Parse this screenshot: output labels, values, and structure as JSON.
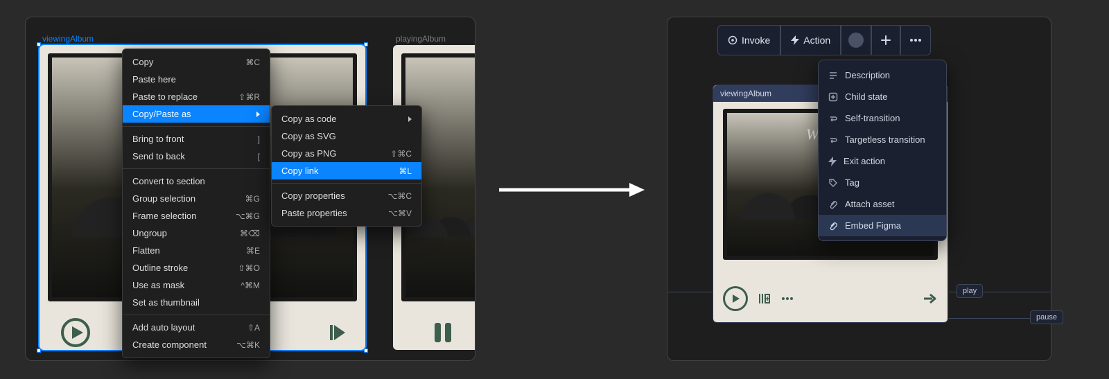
{
  "left": {
    "labels": {
      "viewing": "viewingAlbum",
      "playing": "playingAlbum"
    },
    "menu1": {
      "copy": {
        "label": "Copy",
        "sc": "⌘C"
      },
      "paste_here": {
        "label": "Paste here",
        "sc": ""
      },
      "paste_replace": {
        "label": "Paste to replace",
        "sc": "⇧⌘R"
      },
      "copy_paste_as": {
        "label": "Copy/Paste as",
        "sc": ""
      },
      "bring_front": {
        "label": "Bring to front",
        "sc": "]"
      },
      "send_back": {
        "label": "Send to back",
        "sc": "["
      },
      "convert_sec": {
        "label": "Convert to section",
        "sc": ""
      },
      "group_sel": {
        "label": "Group selection",
        "sc": "⌘G"
      },
      "frame_sel": {
        "label": "Frame selection",
        "sc": "⌥⌘G"
      },
      "ungroup": {
        "label": "Ungroup",
        "sc": "⌘⌫"
      },
      "flatten": {
        "label": "Flatten",
        "sc": "⌘E"
      },
      "outline": {
        "label": "Outline stroke",
        "sc": "⇧⌘O"
      },
      "mask": {
        "label": "Use as mask",
        "sc": "^⌘M"
      },
      "thumb": {
        "label": "Set as thumbnail",
        "sc": ""
      },
      "auto_layout": {
        "label": "Add auto layout",
        "sc": "⇧A"
      },
      "create_comp": {
        "label": "Create component",
        "sc": "⌥⌘K"
      }
    },
    "menu2": {
      "as_code": {
        "label": "Copy as code",
        "sc": ""
      },
      "as_svg": {
        "label": "Copy as SVG",
        "sc": ""
      },
      "as_png": {
        "label": "Copy as PNG",
        "sc": "⇧⌘C"
      },
      "link": {
        "label": "Copy link",
        "sc": "⌘L"
      },
      "props": {
        "label": "Copy properties",
        "sc": "⌥⌘C"
      },
      "pprops": {
        "label": "Paste properties",
        "sc": "⌥⌘V"
      }
    }
  },
  "right": {
    "toolbar": {
      "invoke": "Invoke",
      "action": "Action"
    },
    "state_label": "viewingAlbum",
    "album_title": "Wild W",
    "menu": {
      "description": "Description",
      "child_state": "Child state",
      "self_trans": "Self-transition",
      "targetless": "Targetless transition",
      "exit_action": "Exit action",
      "tag": "Tag",
      "attach_asset": "Attach asset",
      "embed_figma": "Embed Figma"
    },
    "pills": {
      "play": "play",
      "pause": "pause"
    }
  }
}
